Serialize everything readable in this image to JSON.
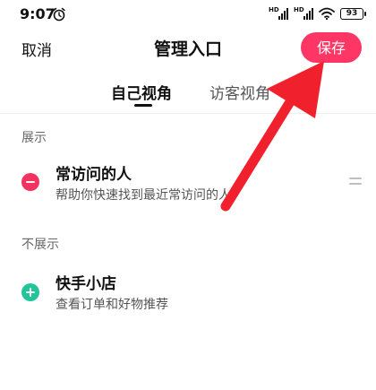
{
  "status_bar": {
    "time": "9:07",
    "alarm_icon": "alarm-clock-icon",
    "signal_1_label": "HD",
    "signal_2_label": "HD",
    "wifi_icon": "wifi-icon",
    "battery_level": "93"
  },
  "header": {
    "cancel_label": "取消",
    "title": "管理入口",
    "save_label": "保存"
  },
  "tabs": [
    {
      "label": "自己视角",
      "active": true
    },
    {
      "label": "访客视角",
      "active": false
    }
  ],
  "sections": [
    {
      "label": "展示",
      "items": [
        {
          "title": "常访问的人",
          "subtitle": "帮助你快速找到最近常访问的人",
          "action_icon": "remove-circle-icon",
          "has_drag_handle": true
        }
      ]
    },
    {
      "label": "不展示",
      "items": [
        {
          "title": "快手小店",
          "subtitle": "查看订单和好物推荐",
          "action_icon": "add-circle-icon",
          "has_drag_handle": false
        }
      ]
    }
  ],
  "annotation": {
    "icon": "red-arrow-icon",
    "color": "#f0212d",
    "points_to": "save-button"
  },
  "colors": {
    "save_button": "#fe3666",
    "remove_icon": "#f2325f",
    "add_icon": "#22c59a",
    "arrow": "#f0212d"
  }
}
